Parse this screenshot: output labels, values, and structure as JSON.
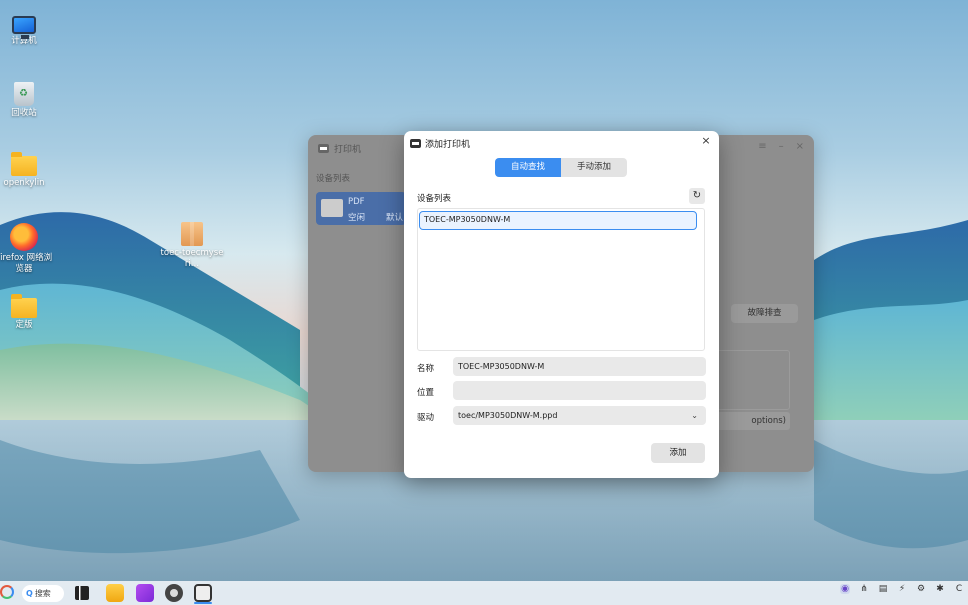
{
  "desktop": {
    "icons": [
      {
        "label": "计算机",
        "icon": "computer-icon"
      },
      {
        "label": "回收站",
        "icon": "trash-icon"
      },
      {
        "label": "openkylin",
        "icon": "folder-icon"
      },
      {
        "label": "Firefox 网络浏览器",
        "icon": "firefox-icon"
      },
      {
        "label": "定版",
        "icon": "folder-icon"
      },
      {
        "label": "toec-toecmyseri…",
        "icon": "package-icon"
      }
    ]
  },
  "background_window": {
    "title": "打印机",
    "device_list_label": "设备列表",
    "device_name": "PDF",
    "device_status": "空闲",
    "device_default": "默认",
    "troubleshoot_button": "故障排查",
    "options_button": "options)"
  },
  "dialog": {
    "title": "添加打印机",
    "close_glyph": "×",
    "tabs": [
      {
        "label": "自动查找",
        "active": true
      },
      {
        "label": "手动添加",
        "active": false
      }
    ],
    "device_list_label": "设备列表",
    "refresh_glyph": "↻",
    "devices": [
      "TOEC-MP3050DNW-M"
    ],
    "name_label": "名称",
    "name_value": "TOEC-MP3050DNW-M",
    "location_label": "位置",
    "location_value": "",
    "driver_label": "驱动",
    "driver_value": "toec/MP3050DNW-M.ppd",
    "add_button": "添加"
  },
  "taskbar": {
    "search_label": "搜索",
    "search_glyph": "Q",
    "tray_glyphs": [
      "◉",
      "⋔",
      "▤",
      "⚡",
      "⚙",
      "✱",
      "C"
    ]
  },
  "colors": {
    "accent": "#3b8df0",
    "selected_row_border": "#3b8df0"
  }
}
